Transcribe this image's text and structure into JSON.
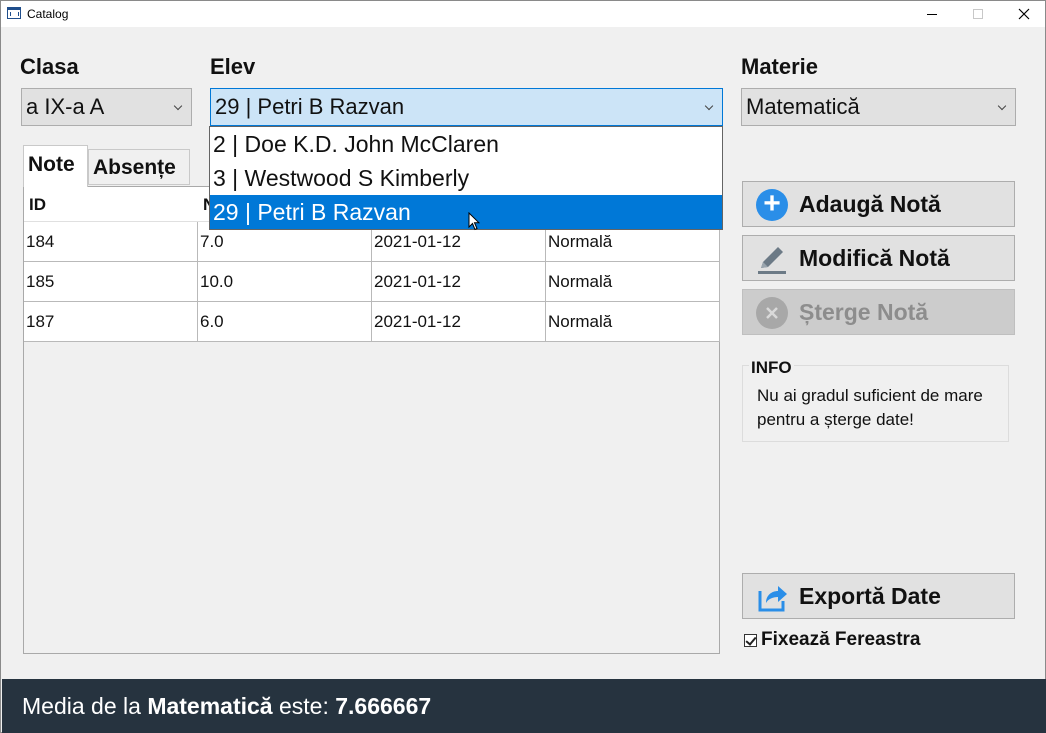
{
  "window": {
    "title": "Catalog"
  },
  "labels": {
    "clasa": "Clasa",
    "elev": "Elev",
    "materie": "Materie"
  },
  "combos": {
    "clasa": "a IX-a A",
    "elev": "29 | Petri B Razvan",
    "materie": "Matematică"
  },
  "elev_dropdown": {
    "items": [
      "2 | Doe K.D. John McClaren",
      "3 | Westwood S Kimberly",
      "29 | Petri B Razvan"
    ],
    "selected_index": 2
  },
  "tabs": [
    {
      "label": "Note",
      "active": true
    },
    {
      "label": "Absențe",
      "active": false
    }
  ],
  "grid": {
    "headers": [
      "ID",
      "N",
      "",
      ""
    ],
    "rows": [
      [
        "184",
        "7.0",
        "2021-01-12",
        "Normală"
      ],
      [
        "185",
        "10.0",
        "2021-01-12",
        "Normală"
      ],
      [
        "187",
        "6.0",
        "2021-01-12",
        "Normală"
      ]
    ]
  },
  "buttons": {
    "add": "Adaugă Notă",
    "edit": "Modifică Notă",
    "delete": "Șterge Notă",
    "export": "Exportă Date"
  },
  "info": {
    "title": "INFO",
    "text": "Nu ai gradul suficient de mare pentru a șterge date!"
  },
  "checkbox": {
    "label": "Fixează Fereastra",
    "checked": true
  },
  "status": {
    "prefix": "Media de la ",
    "subject": "Matematică",
    "middle": " este: ",
    "value": "7.666667"
  },
  "colors": {
    "accent": "#0078d7",
    "statusbar": "#26333f",
    "add_icon": "#2a8ee8"
  }
}
